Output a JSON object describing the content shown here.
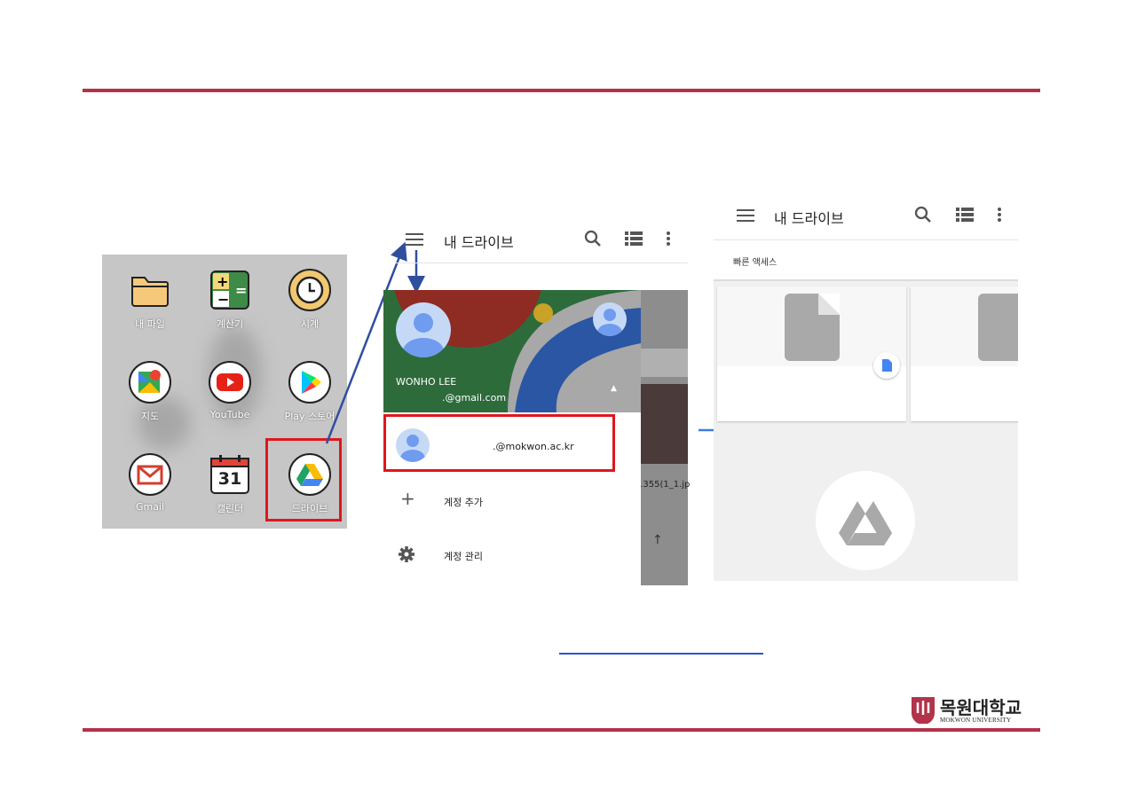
{
  "home_screen": {
    "apps": [
      {
        "label": "내 파일",
        "icon": "folder-icon"
      },
      {
        "label": "계산기",
        "icon": "calculator-icon"
      },
      {
        "label": "시계",
        "icon": "clock-icon"
      },
      {
        "label": "지도",
        "icon": "maps-icon"
      },
      {
        "label": "YouTube",
        "icon": "youtube-icon"
      },
      {
        "label": "Play 스토어",
        "icon": "play-store-icon"
      },
      {
        "label": "Gmail",
        "icon": "gmail-icon"
      },
      {
        "label": "캘린더",
        "icon": "calendar-icon",
        "badge": "31"
      },
      {
        "label": "드라이브",
        "icon": "drive-icon"
      }
    ]
  },
  "drawer": {
    "app_title": "내 드라이브",
    "user_name": "WONHO LEE",
    "user_email": ".@gmail.com",
    "account_email": ".@mokwon.ac.kr",
    "add_account": "계정 추가",
    "manage_accounts": "계정 관리",
    "bg_file_name": "1355(1_1.jp"
  },
  "drive_home": {
    "app_title": "내 드라이브",
    "quick_access": "빠른 액세스"
  },
  "branding": {
    "university_kr": "목원대학교",
    "university_en": "MOKWON UNIVERSITY"
  },
  "colors": {
    "accent_rule": "#b2334a",
    "highlight": "#e0161d",
    "arrow": "#2f4f9e"
  }
}
